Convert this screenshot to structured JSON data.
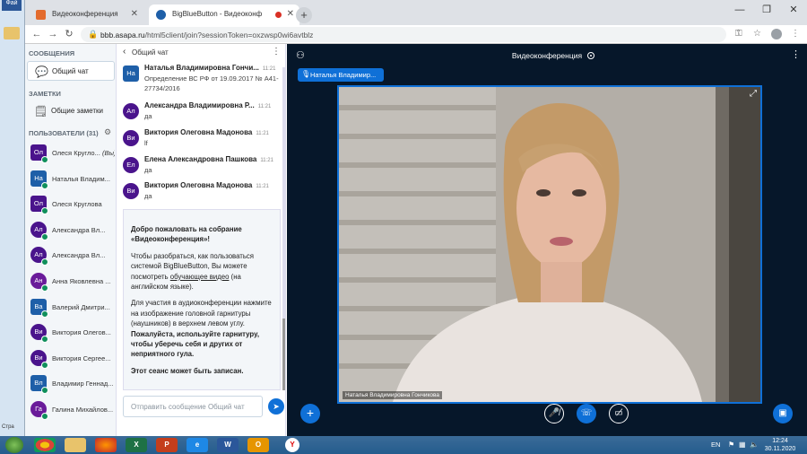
{
  "browser": {
    "tabs": [
      {
        "title": "Видеоконференция",
        "active": false
      },
      {
        "title": "BigBlueButton - Видеоконф",
        "active": true
      }
    ],
    "url_host": "bbb.asapa.ru",
    "url_rest": "/html5client/join?sessionToken=oxzwsp0wi6avtblz"
  },
  "leftstrip": {
    "top_label": "Фай",
    "bottom_label": "Стра"
  },
  "sidebar": {
    "messages_header": "СООБЩЕНИЯ",
    "public_chat": "Общий чат",
    "notes_header": "ЗАМЕТКИ",
    "shared_notes": "Общие заметки",
    "users_header": "ПОЛЬЗОВАТЕЛИ (31)",
    "users": [
      {
        "initials": "Ол",
        "name": "Олеся Кругло...",
        "suffix": "(Вы)",
        "color": "#4a148c",
        "square": true
      },
      {
        "initials": "На",
        "name": "Наталья Владим...",
        "suffix": "",
        "color": "#1e5fa8",
        "square": true
      },
      {
        "initials": "Ол",
        "name": "Олеся Круглова",
        "suffix": "",
        "color": "#4a148c",
        "square": true
      },
      {
        "initials": "Ал",
        "name": "Александра Вл...",
        "suffix": "",
        "color": "#4a148c",
        "square": false
      },
      {
        "initials": "Ал",
        "name": "Александра Вл...",
        "suffix": "",
        "color": "#4a148c",
        "square": false
      },
      {
        "initials": "Ан",
        "name": "Анна Яковлевна ...",
        "suffix": "",
        "color": "#6a1b9a",
        "square": false
      },
      {
        "initials": "Ва",
        "name": "Валерий Дмитри...",
        "suffix": "",
        "color": "#1e5fa8",
        "square": true
      },
      {
        "initials": "Ви",
        "name": "Виктория Олегов...",
        "suffix": "",
        "color": "#4a148c",
        "square": false
      },
      {
        "initials": "Ви",
        "name": "Виктория Сергее...",
        "suffix": "",
        "color": "#4a148c",
        "square": false
      },
      {
        "initials": "Вл",
        "name": "Владимир Геннад...",
        "suffix": "",
        "color": "#1e5fa8",
        "square": true
      },
      {
        "initials": "Га",
        "name": "Галина Михайлов...",
        "suffix": "",
        "color": "#6a1b9a",
        "square": false
      }
    ]
  },
  "chat": {
    "title": "Общий чат",
    "messages": [
      {
        "initials": "На",
        "name": "Наталья Владимировна Гончи...",
        "time": "11:21",
        "text": "Определение ВС РФ от 19.09.2017 № А41-27734/2016",
        "color": "#1e5fa8",
        "square": true
      },
      {
        "initials": "Ал",
        "name": "Александра Владимировна Р...",
        "time": "11:21",
        "text": "да",
        "color": "#4a148c",
        "square": false
      },
      {
        "initials": "Ви",
        "name": "Виктория Олеговна Мадонова",
        "time": "11:21",
        "text": "lf",
        "color": "#4a148c",
        "square": false
      },
      {
        "initials": "Ел",
        "name": "Елена Александровна Пашкова",
        "time": "11:21",
        "text": "да",
        "color": "#4a148c",
        "square": false
      },
      {
        "initials": "Ви",
        "name": "Виктория Олеговна Мадонова",
        "time": "11:21",
        "text": "да",
        "color": "#4a148c",
        "square": false
      }
    ],
    "welcome": {
      "p1_a": "Добро пожаловать на собрание «",
      "p1_b": "Видеоконференция",
      "p1_c": "»!",
      "p2_a": "Чтобы разобраться, как пользоваться системой BigBlueButton, Вы можете посмотреть ",
      "p2_link": "обучающее видео",
      "p2_b": " (на английском языке).",
      "p3_a": "Для участия в аудиоконференции нажмите на изображение головной гарнитуры (наушников) в верхнем левом углу. ",
      "p3_b": "Пожалуйста, используйте гарнитуру, чтобы уберечь себя и других от неприятного гула.",
      "p4": "Этот сеанс может быть записан."
    },
    "input_placeholder": "Отправить сообщение Общий чат"
  },
  "main": {
    "title": "Видеоконференция",
    "talking_indicator": "Наталья Владимир...",
    "video_label": "Наталья Владимировна Гончикова"
  },
  "taskbar": {
    "apps": [
      "Chrome",
      "Explorer",
      "Firefox",
      "Excel",
      "PowerPoint",
      "IE",
      "Word",
      "Outlook",
      "Yandex"
    ],
    "lang": "EN",
    "time": "12:24",
    "date": "30.11.2020"
  }
}
